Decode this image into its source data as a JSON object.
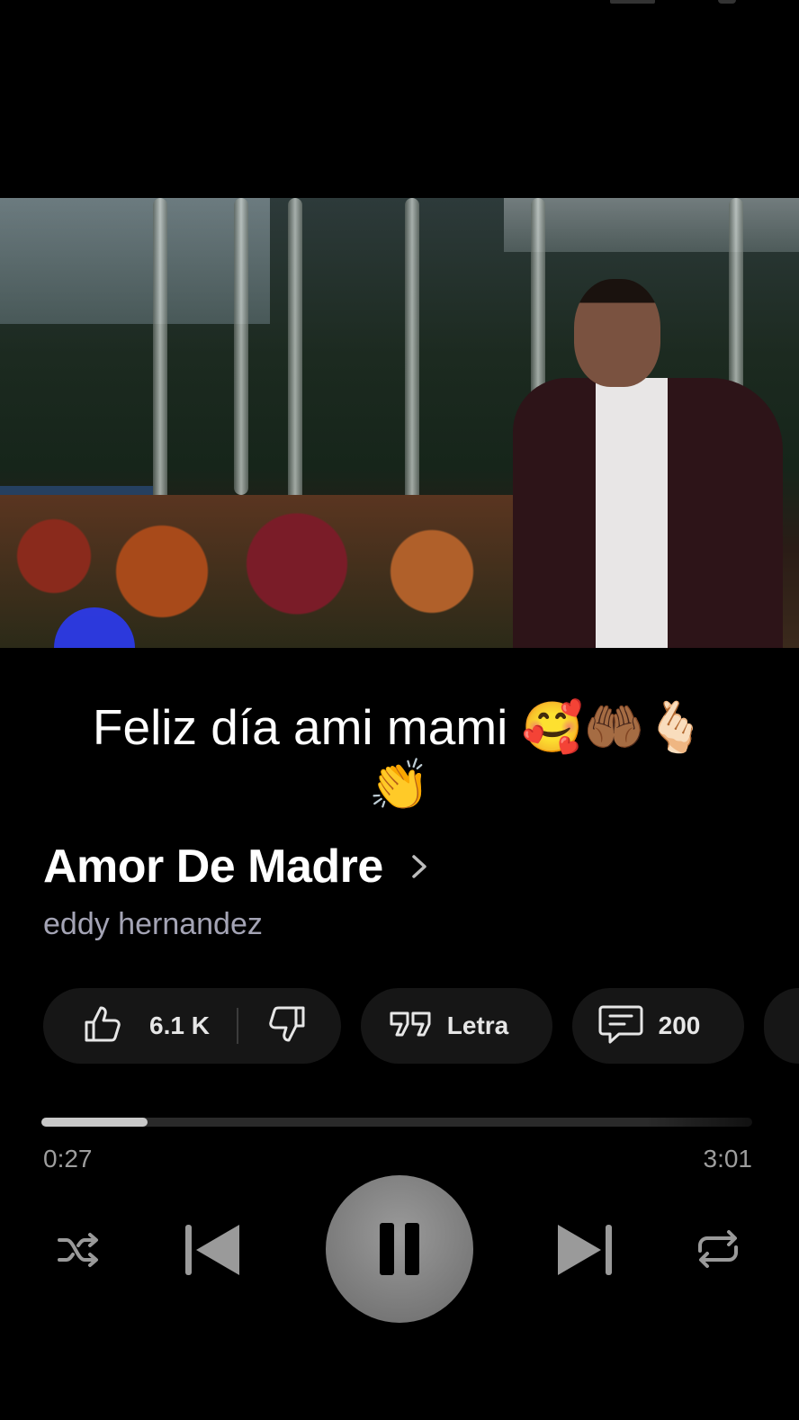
{
  "caption": {
    "line1": "Feliz día ami mami 🥰🤲🏾🫰🏻",
    "line2": "👏"
  },
  "song": {
    "title": "Amor De Madre",
    "artist": "eddy hernandez"
  },
  "actions": {
    "likes": "6.1 K",
    "lyrics_label": "Letra",
    "comments": "200"
  },
  "playback": {
    "current_time": "0:27",
    "total_time": "3:01",
    "progress_fraction": 0.149,
    "state": "playing"
  },
  "icons": {
    "like": "thumbs-up-icon",
    "dislike": "thumbs-down-icon",
    "lyrics": "quote-icon",
    "comments": "comment-icon",
    "shuffle": "shuffle-icon",
    "previous": "skip-previous-icon",
    "pause": "pause-icon",
    "next": "skip-next-icon",
    "repeat": "repeat-icon",
    "chevron": "chevron-right-icon"
  },
  "colors": {
    "background": "#000000",
    "artist_text": "#a4a4b5",
    "pill_bg": "#161616",
    "progress_fill": "#c8c8c8",
    "play_button": "#808080"
  }
}
